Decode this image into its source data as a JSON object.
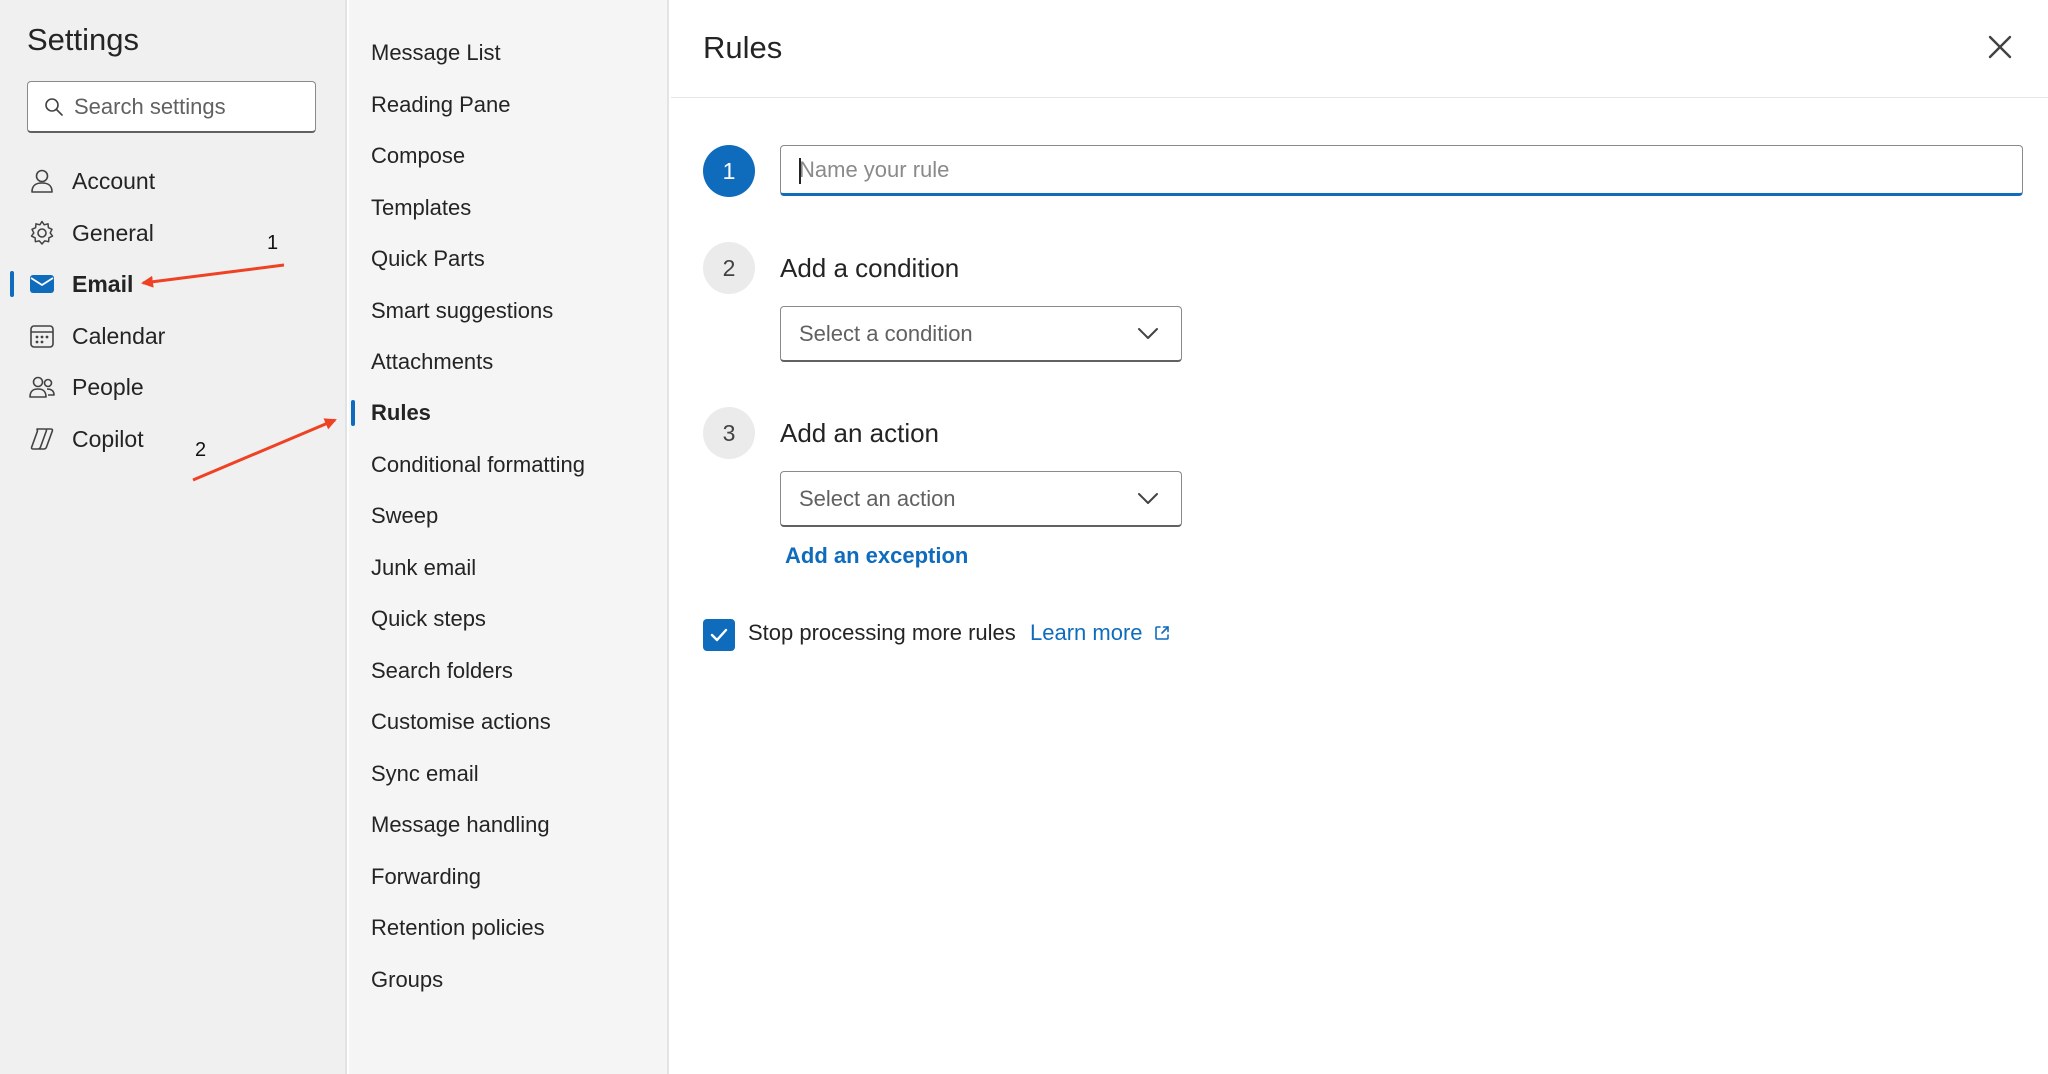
{
  "nav": {
    "title": "Settings",
    "search_placeholder": "Search settings",
    "items": [
      {
        "label": "Account",
        "icon": "person-icon",
        "active": false
      },
      {
        "label": "General",
        "icon": "gear-icon",
        "active": false
      },
      {
        "label": "Email",
        "icon": "mail-icon",
        "active": true
      },
      {
        "label": "Calendar",
        "icon": "calendar-icon",
        "active": false
      },
      {
        "label": "People",
        "icon": "people-icon",
        "active": false
      },
      {
        "label": "Copilot",
        "icon": "copilot-icon",
        "active": false
      }
    ]
  },
  "subnav": {
    "items": [
      {
        "label": "Message List"
      },
      {
        "label": "Reading Pane"
      },
      {
        "label": "Compose"
      },
      {
        "label": "Templates"
      },
      {
        "label": "Quick Parts"
      },
      {
        "label": "Smart suggestions"
      },
      {
        "label": "Attachments"
      },
      {
        "label": "Rules",
        "active": true
      },
      {
        "label": "Conditional formatting"
      },
      {
        "label": "Sweep"
      },
      {
        "label": "Junk email"
      },
      {
        "label": "Quick steps"
      },
      {
        "label": "Search folders"
      },
      {
        "label": "Customise actions"
      },
      {
        "label": "Sync email"
      },
      {
        "label": "Message handling"
      },
      {
        "label": "Forwarding"
      },
      {
        "label": "Retention policies"
      },
      {
        "label": "Groups"
      }
    ]
  },
  "content": {
    "title": "Rules",
    "steps": [
      {
        "number": "1",
        "input_placeholder": "Name your rule",
        "input_value": ""
      },
      {
        "number": "2",
        "title": "Add a condition",
        "dropdown_placeholder": "Select a condition"
      },
      {
        "number": "3",
        "title": "Add an action",
        "dropdown_placeholder": "Select an action"
      }
    ],
    "add_exception_label": "Add an exception",
    "stop_processing": {
      "label": "Stop processing more rules",
      "checked": true
    },
    "learn_more_label": "Learn more"
  },
  "annotations": {
    "marker_1": "1",
    "marker_2": "2",
    "arrow_color": "#ef4123"
  },
  "colors": {
    "accent": "#0f6cbd",
    "nav_bg": "#f0f0f0",
    "subnav_bg": "#f5f5f5"
  }
}
